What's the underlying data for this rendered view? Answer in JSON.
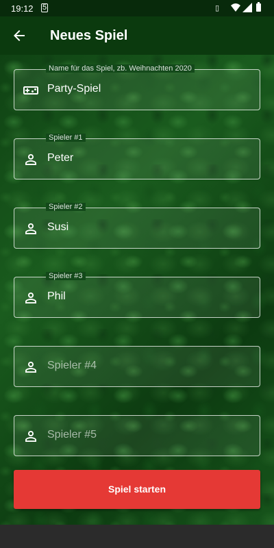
{
  "status_bar": {
    "time": "19:12",
    "sim_icon": "sim-card-icon",
    "icons": [
      "vibrate-icon",
      "wifi-icon",
      "signal-icon",
      "battery-icon"
    ]
  },
  "app_bar": {
    "title": "Neues Spiel",
    "back_icon": "arrow-back-icon"
  },
  "form": {
    "game_name": {
      "label": "Name für das Spiel, zb. Weihnachten 2020",
      "value": "Party-Spiel",
      "icon": "gamepad-icon"
    },
    "players": [
      {
        "label": "Spieler #1",
        "value": "Peter",
        "placeholder": "",
        "icon": "person-icon"
      },
      {
        "label": "Spieler #2",
        "value": "Susi",
        "placeholder": "",
        "icon": "person-icon"
      },
      {
        "label": "Spieler #3",
        "value": "Phil",
        "placeholder": "",
        "icon": "person-icon"
      },
      {
        "label": "",
        "value": "",
        "placeholder": "Spieler #4",
        "icon": "person-icon"
      },
      {
        "label": "",
        "value": "",
        "placeholder": "Spieler #5",
        "icon": "person-icon"
      }
    ]
  },
  "start_button": {
    "label": "Spiel starten"
  },
  "colors": {
    "accent": "#e53935",
    "app_bar": "#0b3a0e",
    "background": "#124a16"
  }
}
